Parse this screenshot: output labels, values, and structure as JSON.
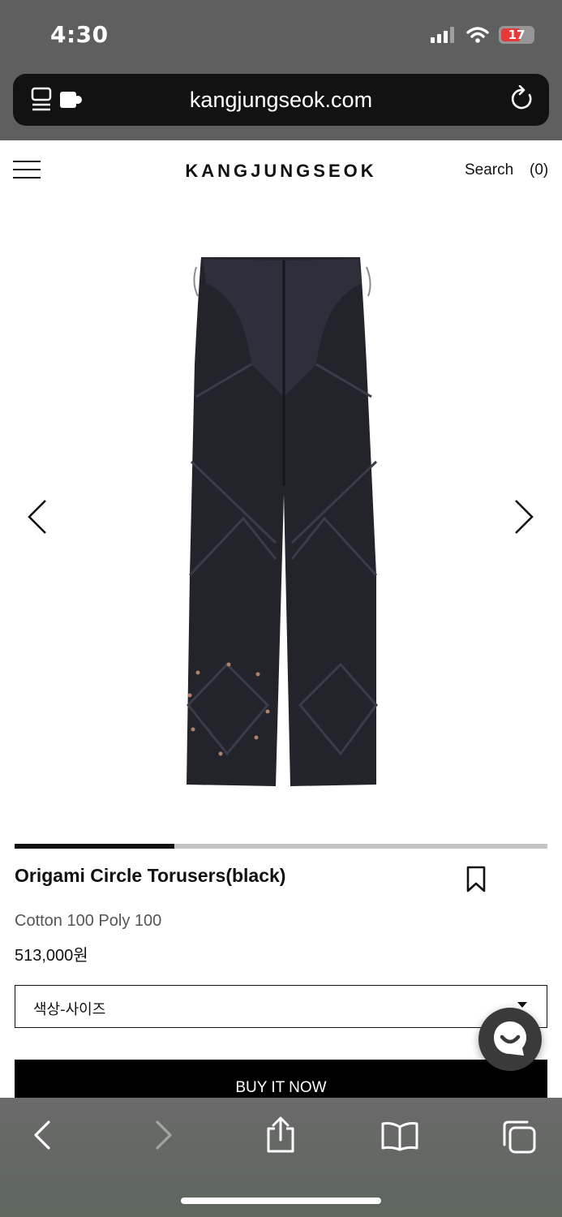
{
  "status_bar": {
    "time": "4:30",
    "battery": "17",
    "icons": [
      "cellular-signal-icon",
      "wifi-icon",
      "battery-charging-icon"
    ]
  },
  "browser": {
    "url": "kangjungseok.com",
    "icons": [
      "reader-extensions-icon",
      "reload-icon"
    ]
  },
  "site_header": {
    "logo": "KANGJUNGSEOK",
    "search_label": "Search",
    "cart_count": "(0)"
  },
  "gallery": {
    "progress_fraction": 0.3
  },
  "product": {
    "name": "Origami Circle Torusers(black)",
    "description": "Cotton 100 Poly 100",
    "price": "513,000원",
    "option_selected": "색상-사이즈",
    "buy_label": "BUY IT NOW"
  },
  "toolbar": {
    "icons": [
      "back-icon",
      "forward-icon",
      "share-icon",
      "bookmarks-icon",
      "tabs-icon"
    ]
  },
  "colors": {
    "chrome_bg": "#5f5f5f",
    "battery_red": "#e5393a",
    "button_black": "#000000"
  }
}
